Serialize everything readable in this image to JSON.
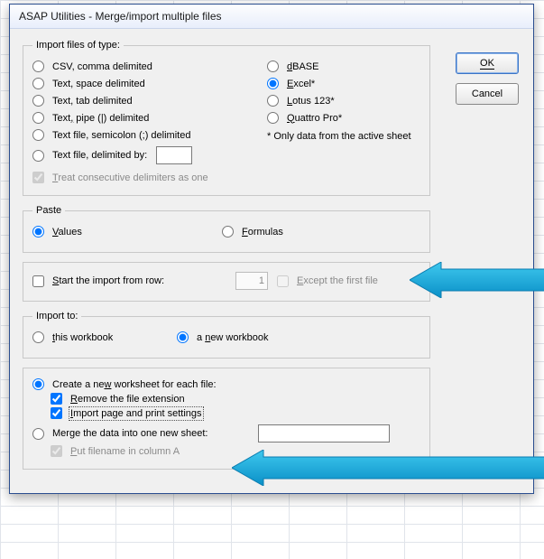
{
  "window": {
    "title": "ASAP Utilities - Merge/import multiple files"
  },
  "buttons": {
    "ok": "OK",
    "cancel": "Cancel"
  },
  "importTypes": {
    "legend": "Import files of type:",
    "left": [
      "CSV, comma delimited",
      "Text, space delimited",
      "Text, tab delimited",
      "Text, pipe (|) delimited",
      "Text file, semicolon (;) delimited",
      "Text file, delimited by:"
    ],
    "right": [
      "dBASE",
      "Excel*",
      "Lotus 123*",
      "Quattro Pro*"
    ],
    "note": "* Only data from the active sheet",
    "treatConsecutive": "Treat consecutive delimiters as one"
  },
  "paste": {
    "legend": "Paste",
    "values": "Values",
    "formulas": "Formulas"
  },
  "startRow": {
    "label": "Start the import from row:",
    "value": "1",
    "except": "Except the first file"
  },
  "importTo": {
    "legend": "Import to:",
    "thisWb": "this workbook",
    "newWb": "a new workbook"
  },
  "create": {
    "newSheet": "Create a new worksheet for each file:",
    "removeExt": "Remove the file extension",
    "importPage": "Import page and print settings",
    "merge": "Merge the data into one new sheet:",
    "putFilename": "Put filename in column A"
  }
}
